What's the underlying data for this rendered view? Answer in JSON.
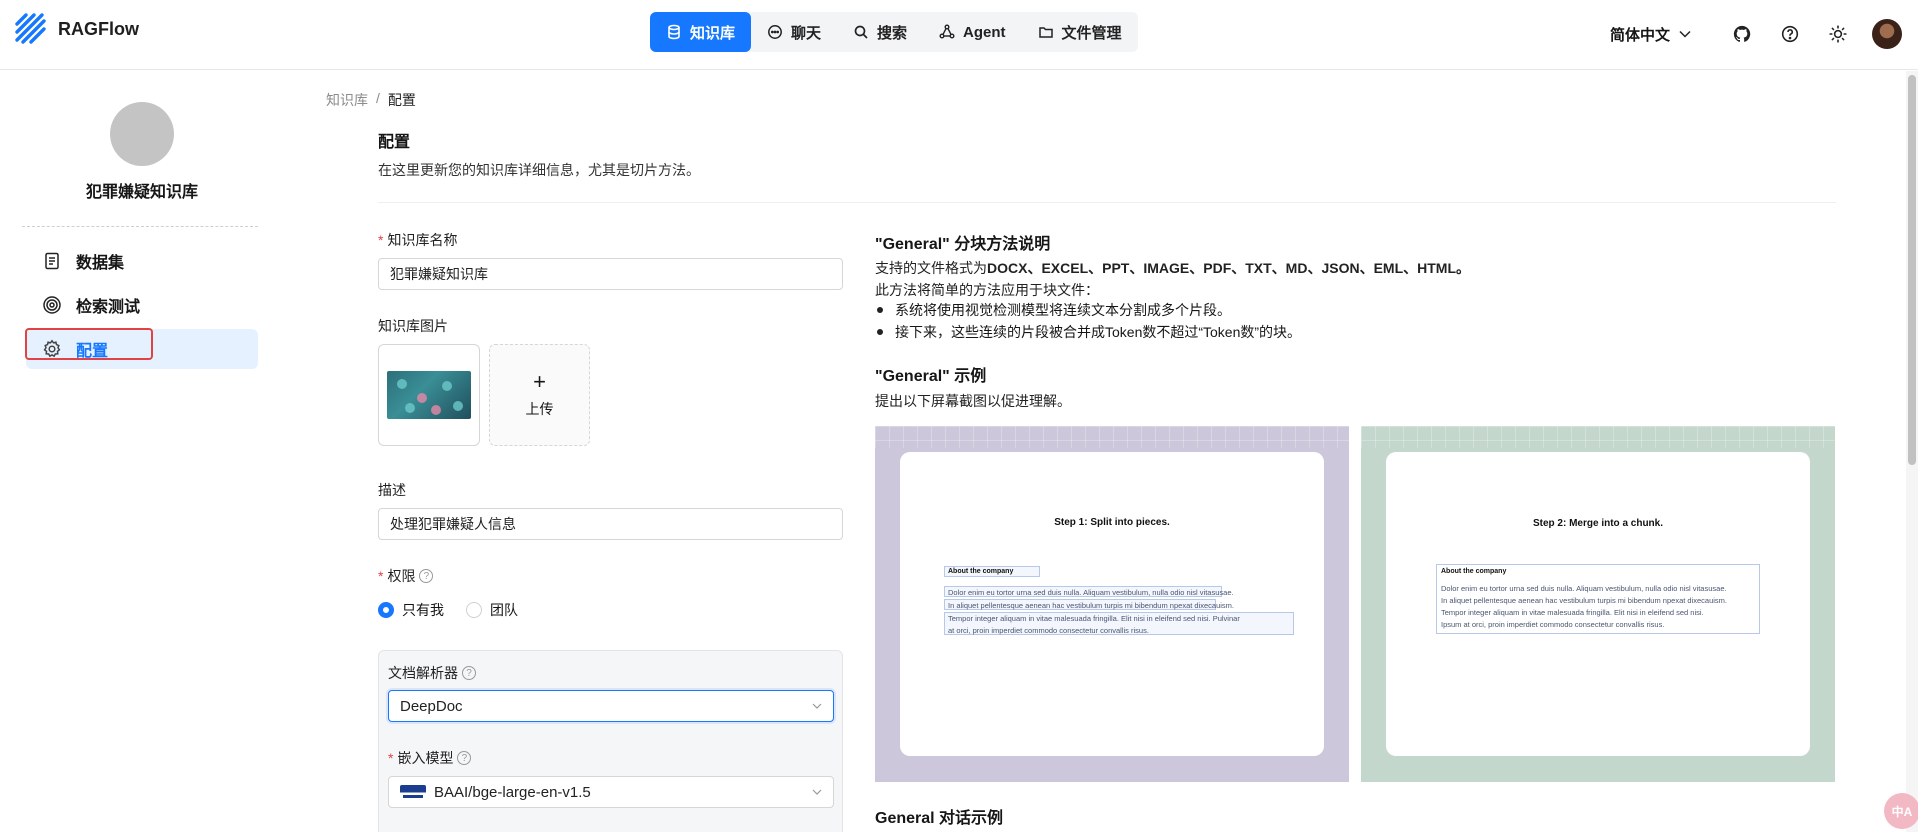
{
  "app": {
    "name": "RAGFlow"
  },
  "nav": {
    "items": [
      {
        "label": "知识库",
        "active": true
      },
      {
        "label": "聊天",
        "active": false
      },
      {
        "label": "搜索",
        "active": false
      },
      {
        "label": "Agent",
        "active": false
      },
      {
        "label": "文件管理",
        "active": false
      }
    ]
  },
  "toolbar": {
    "language": "简体中文"
  },
  "sidebar": {
    "kb_name": "犯罪嫌疑知识库",
    "items": [
      {
        "label": "数据集",
        "icon": "document-icon"
      },
      {
        "label": "检索测试",
        "icon": "target-icon"
      },
      {
        "label": "配置",
        "icon": "gear-icon",
        "active": true
      }
    ]
  },
  "breadcrumb": {
    "root": "知识库",
    "sep": "/",
    "current": "配置"
  },
  "page": {
    "title": "配置",
    "description": "在这里更新您的知识库详细信息，尤其是切片方法。"
  },
  "form": {
    "name_label": "知识库名称",
    "name_value": "犯罪嫌疑知识库",
    "image_label": "知识库图片",
    "upload_label": "上传",
    "upload_plus": "+",
    "desc_label": "描述",
    "desc_value": "处理犯罪嫌疑人信息",
    "permission_label": "权限",
    "permission_options": [
      "只有我",
      "团队"
    ],
    "parser_label": "文档解析器",
    "parser_value": "DeepDoc",
    "embed_label": "嵌入模型",
    "embed_value": "BAAI/bge-large-en-v1.5",
    "required_mark": "*",
    "help_mark": "?"
  },
  "right_panel": {
    "heading1": "\"General\" 分块方法说明",
    "formats_prefix": "支持的文件格式为",
    "formats": "DOCX、EXCEL、PPT、IMAGE、PDF、TXT、MD、JSON、EML、HTML。",
    "intro": "此方法将简单的方法应用于块文件：",
    "bullets": [
      "系统将使用视觉检测模型将连续文本分割成多个片段。",
      "接下来，这些连续的片段被合并成Token数不超过“Token数”的块。"
    ],
    "heading2": "\"General\" 示例",
    "example_desc": "提出以下屏幕截图以促进理解。",
    "step1": "Step 1: Split into pieces.",
    "step2": "Step 2: Merge into a chunk.",
    "sample_title": "About the company",
    "sample_lines": [
      "Dolor enim eu tortor urna sed duis nulla. Aliquam vestibulum, nulla odio nisl vitasusae.",
      "In aliquet pellentesque aenean hac vestibulum turpis mi bibendum npexat dixecauism.",
      "Tempor integer aliquam in vitae malesuada fringilla. Elit nisi in eleifend sed nisi. Pulvinar",
      "at orci, proin imperdiet commodo consectetur convallis risus."
    ],
    "merged_lines": [
      "Dolor enim eu tortor urna sed duis nulla. Aliquam vestibulum, nulla odio nisl vitasusae.",
      "In aliquet pellentesque aenean hac vestibulum turpis mi bibendum npexat dixecauism.",
      "Tempor integer aliquam in vitae malesuada fringilla. Elit nisi in eleifend sed nisi.",
      "Ipsum at orci, proin imperdiet commodo consectetur convallis risus."
    ],
    "heading3": "General 对话示例"
  },
  "floating": {
    "label": "中A"
  },
  "colors": {
    "accent": "#1677ff",
    "required": "#e04343",
    "highlight": "#e04343"
  }
}
